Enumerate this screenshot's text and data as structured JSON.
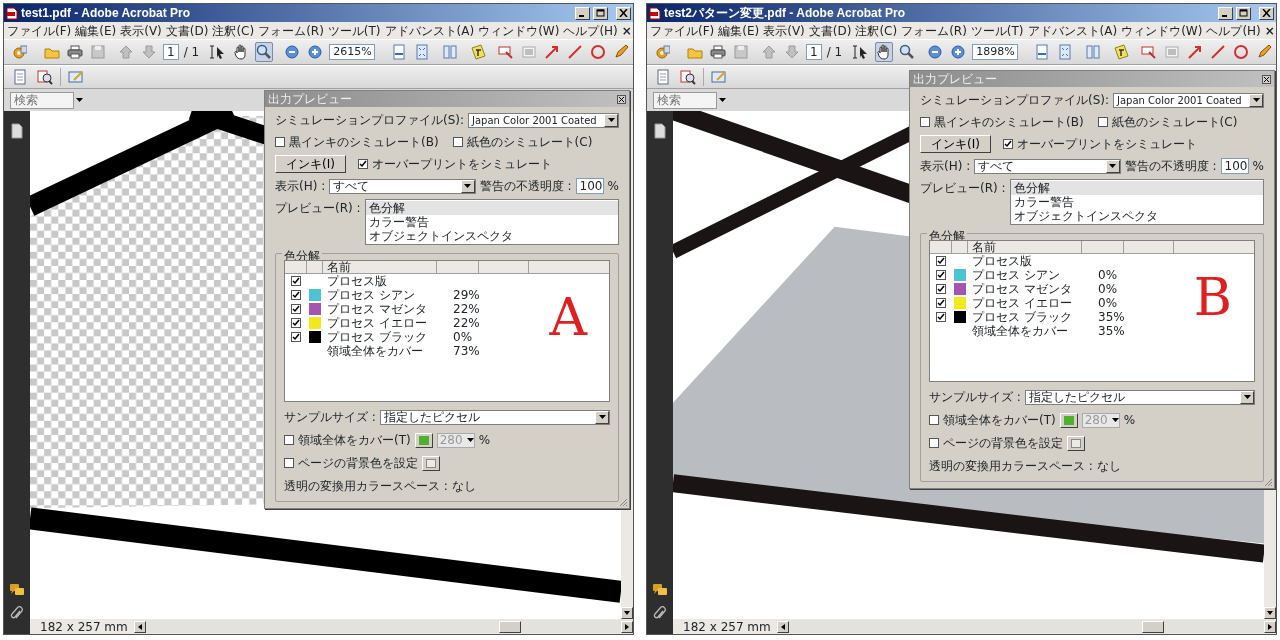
{
  "windows": [
    {
      "title": "test1.pdf - Adobe Acrobat Pro",
      "menu": [
        "ファイル(F)",
        "編集(E)",
        "表示(V)",
        "文書(D)",
        "注釈(C)",
        "フォーム(R)",
        "ツール(T)",
        "アドバンスト(A)",
        "ウィンドウ(W)",
        "ヘルプ(H)"
      ],
      "doc_close": "×",
      "page": "1",
      "page_total": "/ 1",
      "zoom": "2615%",
      "tools": [
        {
          "kind": "select",
          "selected": false
        },
        {
          "kind": "hand",
          "selected": false
        },
        {
          "kind": "zoom",
          "selected": true
        }
      ],
      "search": {
        "placeholder": "検索"
      },
      "canvas": {
        "kind": "checker"
      },
      "status": "182 x 257 mm",
      "dialog": {
        "kind": "lower",
        "title": "出力プレビュー",
        "profile_label": "シミュレーションプロファイル(S):",
        "profile": "Japan Color 2001 Coated",
        "black_ink": {
          "label": "黒インキのシミュレート(B)",
          "checked": false
        },
        "paper": {
          "label": "紙色のシミュレート(C)",
          "checked": false
        },
        "ink_button": "インキ(I)",
        "overprint": {
          "label": "オーバープリントをシミュレート",
          "checked": true
        },
        "show_label": "表示(H) :",
        "show": "すべて",
        "opacity_label": "警告の不透明度 :",
        "opacity": "100",
        "opacity_unit": "%",
        "preview_label": "プレビュー(R) :",
        "preview_items": [
          {
            "label": "色分解",
            "selected": true
          },
          {
            "label": "カラー警告",
            "selected": false
          },
          {
            "label": "オブジェクトインスペクタ",
            "selected": false
          }
        ],
        "group_title": "色分解",
        "column_name": "名前",
        "separations": [
          {
            "kind": "group",
            "name": "プロセス版",
            "checked": true
          },
          {
            "kind": "ink",
            "name": "プロセス シアン",
            "checked": true,
            "color": "#4fc3d6",
            "coverage": "29%"
          },
          {
            "kind": "ink",
            "name": "プロセス マゼンタ",
            "checked": true,
            "color": "#a554b0",
            "coverage": "22%"
          },
          {
            "kind": "ink",
            "name": "プロセス イエロー",
            "checked": true,
            "color": "#f2e81e",
            "coverage": "22%"
          },
          {
            "kind": "ink",
            "name": "プロセス ブラック",
            "checked": true,
            "color": "#000000",
            "coverage": "0%"
          },
          {
            "kind": "total",
            "name": "領域全体をカバー",
            "coverage": "73%"
          }
        ],
        "handwriting": "A",
        "sample_label": "サンプルサイズ :",
        "sample": "指定したピクセル",
        "cover": {
          "label": "領域全体をカバー(T)",
          "checked": false,
          "value": "280",
          "unit": "%"
        },
        "page_bg": {
          "label": "ページの背景色を設定",
          "checked": false
        },
        "transparency_label": "透明の変換用カラースペース :",
        "transparency": "なし"
      }
    },
    {
      "title": "test2パターン変更.pdf - Adobe Acrobat Pro",
      "menu": [
        "ファイル(F)",
        "編集(E)",
        "表示(V)",
        "文書(D)",
        "注釈(C)",
        "フォーム(R)",
        "ツール(T)",
        "アドバンスト(A)",
        "ウィンドウ(W)",
        "ヘルプ(H)"
      ],
      "doc_close": "×",
      "page": "1",
      "page_total": "/ 1",
      "zoom": "1898%",
      "tools": [
        {
          "kind": "select",
          "selected": false
        },
        {
          "kind": "hand",
          "selected": true
        },
        {
          "kind": "zoom",
          "selected": false
        }
      ],
      "search": {
        "placeholder": "検索"
      },
      "canvas": {
        "kind": "gray"
      },
      "status": "182 x 257 mm",
      "dialog": {
        "kind": "upper",
        "title": "出力プレビュー",
        "profile_label": "シミュレーションプロファイル(S):",
        "profile": "Japan Color 2001 Coated",
        "black_ink": {
          "label": "黒インキのシミュレート(B)",
          "checked": false
        },
        "paper": {
          "label": "紙色のシミュレート(C)",
          "checked": false
        },
        "ink_button": "インキ(I)",
        "overprint": {
          "label": "オーバープリントをシミュレート",
          "checked": true
        },
        "show_label": "表示(H) :",
        "show": "すべて",
        "opacity_label": "警告の不透明度 :",
        "opacity": "100",
        "opacity_unit": "%",
        "preview_label": "プレビュー(R) :",
        "preview_items": [
          {
            "label": "色分解",
            "selected": true
          },
          {
            "label": "カラー警告",
            "selected": false
          },
          {
            "label": "オブジェクトインスペクタ",
            "selected": false
          }
        ],
        "group_title": "色分解",
        "column_name": "名前",
        "separations": [
          {
            "kind": "group",
            "name": "プロセス版",
            "checked": true
          },
          {
            "kind": "ink",
            "name": "プロセス シアン",
            "checked": true,
            "color": "#4fc3d6",
            "coverage": "0%"
          },
          {
            "kind": "ink",
            "name": "プロセス マゼンタ",
            "checked": true,
            "color": "#a554b0",
            "coverage": "0%"
          },
          {
            "kind": "ink",
            "name": "プロセス イエロー",
            "checked": true,
            "color": "#f2e81e",
            "coverage": "0%"
          },
          {
            "kind": "ink",
            "name": "プロセス ブラック",
            "checked": true,
            "color": "#000000",
            "coverage": "35%"
          },
          {
            "kind": "total",
            "name": "領域全体をカバー",
            "coverage": "35%"
          }
        ],
        "handwriting": "B",
        "sample_label": "サンプルサイズ :",
        "sample": "指定したピクセル",
        "cover": {
          "label": "領域全体をカバー(T)",
          "checked": false,
          "value": "280",
          "unit": "%"
        },
        "page_bg": {
          "label": "ページの背景色を設定",
          "checked": false
        },
        "transparency_label": "透明の変換用カラースペース :",
        "transparency": "なし"
      }
    }
  ]
}
